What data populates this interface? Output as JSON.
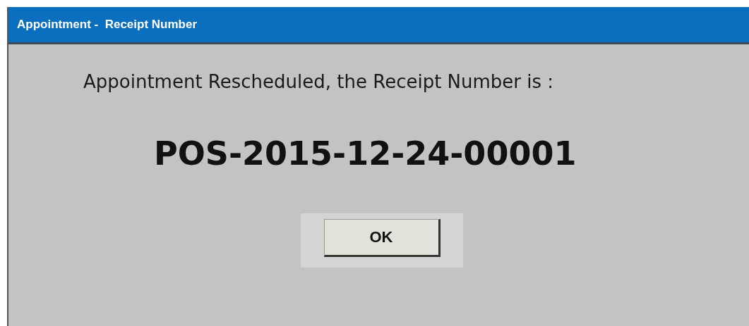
{
  "window": {
    "title": "Appointment -  Receipt Number"
  },
  "message": "Appointment Rescheduled, the Receipt Number is :",
  "receipt_number": "POS-2015-12-24-00001",
  "buttons": [
    "OK"
  ]
}
